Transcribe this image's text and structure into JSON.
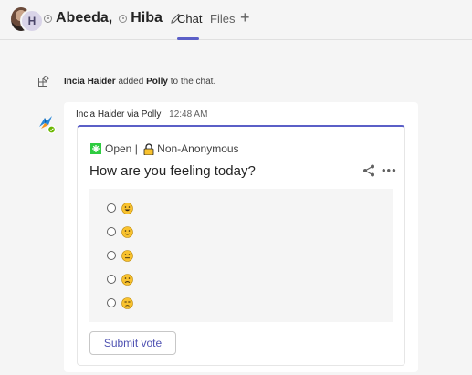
{
  "header": {
    "avatar_initial": "H",
    "participant_1": "Abeeda,",
    "participant_2": "Hiba",
    "tabs": [
      {
        "label": "Chat"
      },
      {
        "label": "Files"
      }
    ],
    "add_tab_icon": "plus-icon"
  },
  "system_message": {
    "actor": "Incia Haider",
    "text_1": " added ",
    "app": "Polly",
    "text_2": " to the chat."
  },
  "message": {
    "sender": "Incia Haider via Polly",
    "time": "12:48 AM"
  },
  "poll": {
    "status": "Open",
    "separator": " | ",
    "visibility": "Non-Anonymous",
    "question": "How are you feeling today?",
    "options": [
      {
        "emoji": "grinning-face"
      },
      {
        "emoji": "slightly-smiling-face"
      },
      {
        "emoji": "neutral-face"
      },
      {
        "emoji": "slightly-frowning-face"
      },
      {
        "emoji": "unamused-face"
      }
    ],
    "submit_label": "Submit vote"
  },
  "colors": {
    "accent": "#5b5fc7",
    "background": "#f5f5f5",
    "emoji_yellow": "#f9c22e",
    "open_green": "#2ecc40"
  }
}
